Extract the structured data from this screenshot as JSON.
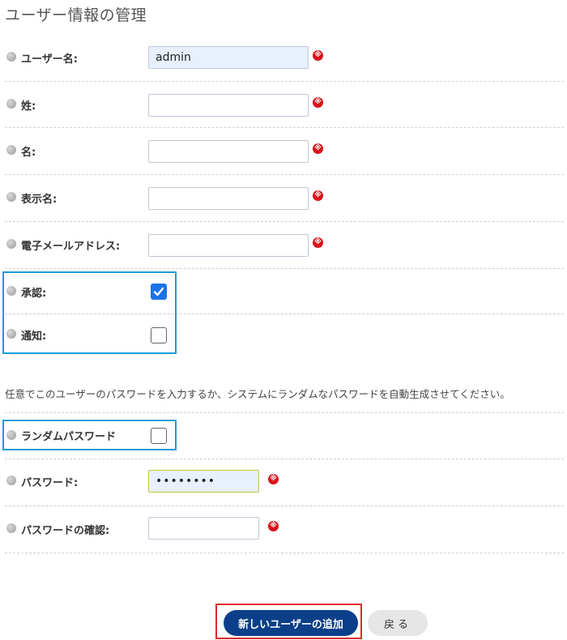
{
  "page": {
    "title": "ユーザー情報の管理"
  },
  "fields": {
    "username": {
      "label": "ユーザー名:",
      "value": "admin"
    },
    "lastname": {
      "label": "姓:",
      "value": ""
    },
    "firstname": {
      "label": "名:",
      "value": ""
    },
    "displayname": {
      "label": "表示名:",
      "value": ""
    },
    "email": {
      "label": "電子メールアドレス:",
      "value": ""
    },
    "approve": {
      "label": "承認:",
      "checked": true
    },
    "notify": {
      "label": "通知:",
      "checked": false
    },
    "random_password": {
      "label": "ランダムパスワード",
      "checked": false
    },
    "password": {
      "label": "パスワード:",
      "value": "••••••••"
    },
    "password_confirm": {
      "label": "パスワードの確認:",
      "value": ""
    }
  },
  "password_note": "任意でこのユーザーのパスワードを入力するか、システムにランダムなパスワードを自動生成させてください。",
  "required_mark": "※",
  "buttons": {
    "add_user": "新しいユーザーの追加",
    "back": "戻る"
  },
  "colors": {
    "primary": "#0c3f8a",
    "required": "#d9131b",
    "highlight_blue": "#1a9bd7",
    "highlight_red": "#e0282e",
    "checkbox": "#1a73e8"
  }
}
